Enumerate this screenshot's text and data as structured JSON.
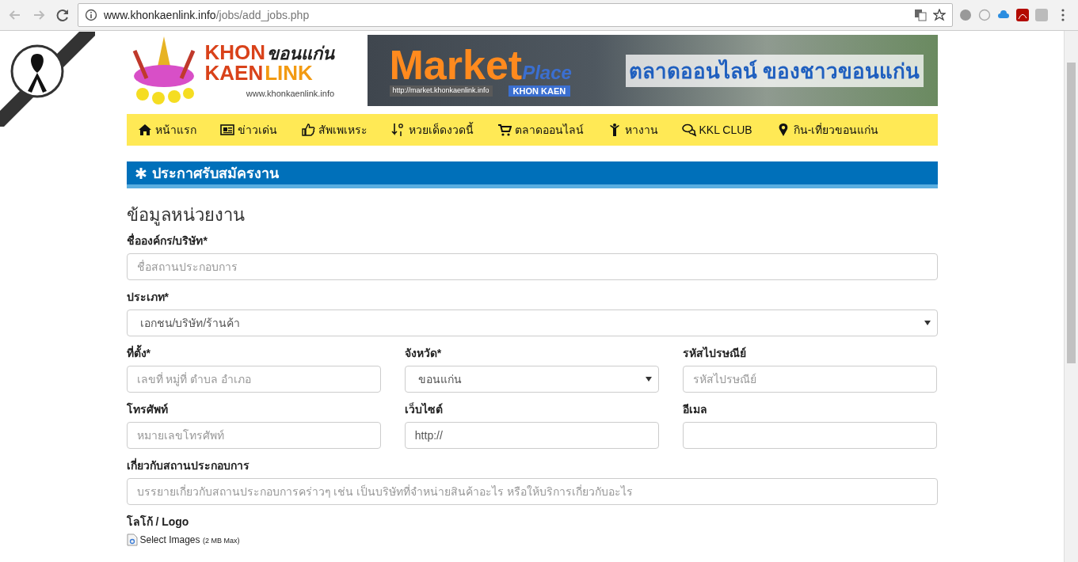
{
  "browser": {
    "url_host": "www.khonkaenlink.info",
    "url_path": "/jobs/add_jobs.php"
  },
  "logo": {
    "top": "KHON",
    "bottom": "KAEN",
    "thai": "ขอนแก่น",
    "link": "LINK",
    "url": "www.khonkaenlink.info"
  },
  "banner": {
    "title": "Market",
    "subtitle": "Place",
    "url": "http://market.khonkaenlink.info",
    "city": "KHON KAEN",
    "tagline": "ตลาดออนไลน์ ของชาวขอนแก่น"
  },
  "nav": [
    {
      "label": "หน้าแรก"
    },
    {
      "label": "ข่าวเด่น"
    },
    {
      "label": "สัพเพเหระ"
    },
    {
      "label": "หวยเด็ดงวดนี้"
    },
    {
      "label": "ตลาดออนไลน์"
    },
    {
      "label": "หางาน"
    },
    {
      "label": "KKL CLUB"
    },
    {
      "label": "กิน-เที่ยวขอนแก่น"
    }
  ],
  "heading": "ประกาศรับสมัครงาน",
  "section_title": "ข้อมูลหน่วยงาน",
  "rows": [
    [
      {
        "kind": "text",
        "label": "ชื่อองค์กร/บริษัท*",
        "placeholder": "ชื่อสถานประกอบการ"
      }
    ],
    [
      {
        "kind": "select",
        "label": "ประเภท*",
        "value": "เอกชน/บริษัท/ร้านค้า"
      }
    ],
    [
      {
        "kind": "text",
        "label": "ที่ตั้ง*",
        "placeholder": "เลขที่ หมู่ที่ ตำบล อำเภอ"
      },
      {
        "kind": "select",
        "label": "จังหวัด*",
        "value": "ขอนแก่น"
      },
      {
        "kind": "text",
        "label": "รหัสไปรษณีย์",
        "placeholder": "รหัสไปรษณีย์"
      }
    ],
    [
      {
        "kind": "text",
        "label": "โทรศัพท์",
        "placeholder": "หมายเลขโทรศัพท์"
      },
      {
        "kind": "text",
        "label": "เว็บไซต์",
        "value": "http://"
      },
      {
        "kind": "text",
        "label": "อีเมล"
      }
    ],
    [
      {
        "kind": "text",
        "label": "เกี่ยวกับสถานประกอบการ",
        "placeholder": "บรรยายเกี่ยวกับสถานประกอบการคร่าวๆ เช่น เป็นบริษัทที่จำหน่ายสินค้าอะไร หรือให้บริการเกี่ยวกับอะไร"
      }
    ]
  ],
  "logo_field": {
    "label": "โลโก้ / Logo",
    "button": "Select Images",
    "note": "(2 MB Max)"
  }
}
